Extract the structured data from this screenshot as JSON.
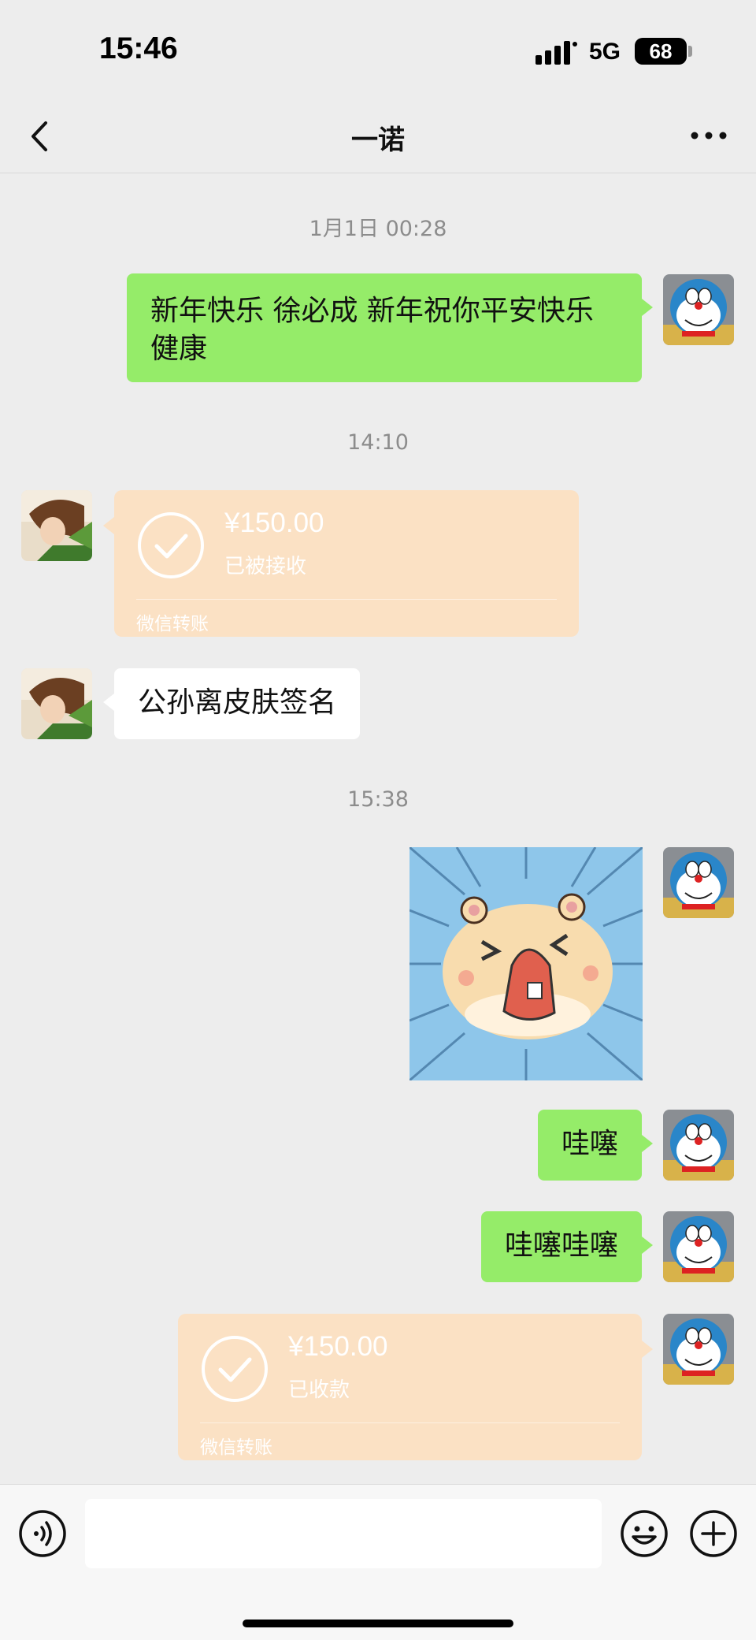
{
  "status_bar": {
    "time": "15:46",
    "network": "5G",
    "battery": "68"
  },
  "header": {
    "title": "一诺",
    "back_icon": "chevron-left-icon",
    "more_icon": "ellipsis-icon"
  },
  "colors": {
    "my_bubble": "#95ec69",
    "other_bubble": "#ffffff",
    "transfer_card": "#fbe1c4",
    "background": "#ededed"
  },
  "messages": [
    {
      "type": "time",
      "text": "1月1日 00:28"
    },
    {
      "type": "text",
      "sender": "me",
      "text_line1": "新年快乐 徐必成 新年祝你平安快乐",
      "text_line2": "健康"
    },
    {
      "type": "time",
      "text": "14:10"
    },
    {
      "type": "transfer",
      "sender": "other",
      "amount": "¥150.00",
      "status": "已被接收",
      "label": "微信转账"
    },
    {
      "type": "text",
      "sender": "other",
      "text": "公孙离皮肤签名"
    },
    {
      "type": "time",
      "text": "15:38"
    },
    {
      "type": "sticker",
      "sender": "me",
      "icon": "hamster-sticker"
    },
    {
      "type": "text",
      "sender": "me",
      "text": "哇噻"
    },
    {
      "type": "text",
      "sender": "me",
      "text": "哇噻哇噻"
    },
    {
      "type": "transfer",
      "sender": "me",
      "amount": "¥150.00",
      "status": "已收款",
      "label": "微信转账"
    }
  ],
  "input_bar": {
    "voice_icon": "voice-icon",
    "emoji_icon": "emoji-icon",
    "plus_icon": "plus-icon",
    "text_value": ""
  }
}
